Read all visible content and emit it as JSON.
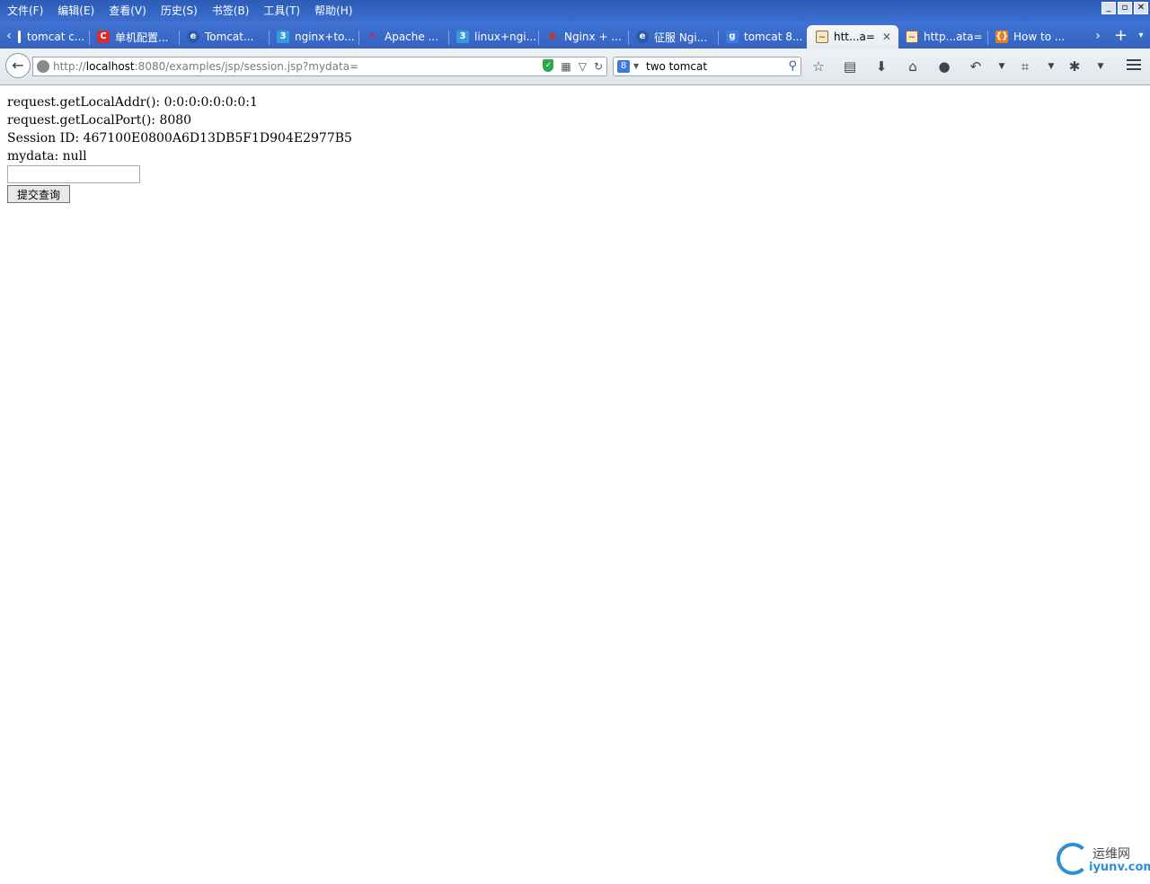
{
  "menu": [
    "文件(F)",
    "编辑(E)",
    "查看(V)",
    "历史(S)",
    "书签(B)",
    "工具(T)",
    "帮助(H)"
  ],
  "window_buttons": [
    "_",
    "▫",
    "✕"
  ],
  "tabs": [
    {
      "title": "tomcat c...",
      "icon": "bar-icon",
      "color": "#ffffff"
    },
    {
      "title": "单机配置...",
      "icon": "c-icon",
      "color": "#d32f2f"
    },
    {
      "title": "Tomcat...",
      "icon": "e-icon",
      "color": "#2b5aa8"
    },
    {
      "title": "nginx+to...",
      "icon": "bs-icon",
      "color": "#3a9ad9"
    },
    {
      "title": "Apache ...",
      "icon": "feather-icon",
      "color": "#b0306a"
    },
    {
      "title": "linux+ngi...",
      "icon": "bs-icon",
      "color": "#3a9ad9"
    },
    {
      "title": "Nginx + ...",
      "icon": "cube-icon",
      "color": "#c0392b"
    },
    {
      "title": "征服 Ngi...",
      "icon": "e-icon",
      "color": "#2b5aa8"
    },
    {
      "title": "tomcat 8...",
      "icon": "g-icon",
      "color": "#3b7be0"
    },
    {
      "title": "htt...a=",
      "icon": "page-icon",
      "color": "#8a6d3b",
      "active": true
    },
    {
      "title": "http...ata=",
      "icon": "page-icon",
      "color": "#8a6d3b"
    },
    {
      "title": "How to ...",
      "icon": "braces-icon",
      "color": "#e67e22"
    }
  ],
  "url": {
    "prefix": "http://",
    "host": "localhost",
    "rest": ":8080/examples/jsp/session.jsp?mydata="
  },
  "search": {
    "value": "two tomcat",
    "engine_glyph": "8"
  },
  "toolbar_icons": [
    "star-icon",
    "clipboard-icon",
    "download-icon",
    "home-icon",
    "chat-icon",
    "undo-icon",
    "crop-icon",
    "bug-icon"
  ],
  "page": {
    "line1": "request.getLocalAddr(): 0:0:0:0:0:0:0:1",
    "line2": "request.getLocalPort(): 8080",
    "line3": "Session ID: 467100E0800A6D13DB5F1D904E2977B5",
    "line4": "mydata: null",
    "input_value": "",
    "submit_label": "提交查询"
  },
  "watermark": {
    "cn": "运维网",
    "en": "iyunv.com"
  }
}
